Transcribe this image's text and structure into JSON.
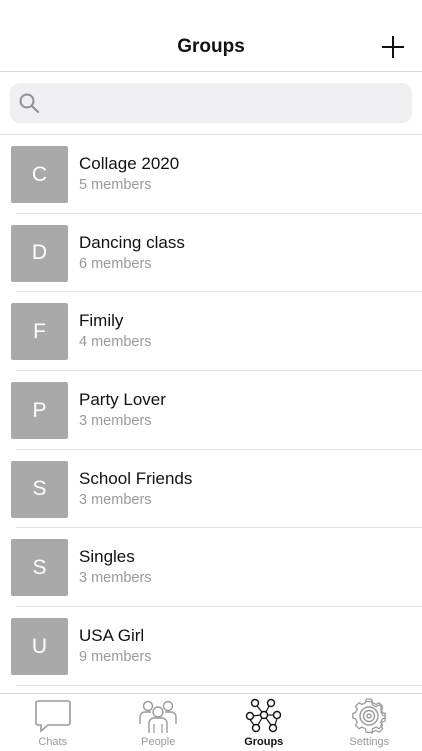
{
  "header": {
    "title": "Groups"
  },
  "search": {
    "placeholder": ""
  },
  "groups": [
    {
      "initial": "C",
      "name": "Collage 2020",
      "members": "5 members"
    },
    {
      "initial": "D",
      "name": "Dancing class",
      "members": "6 members"
    },
    {
      "initial": "F",
      "name": "Fimily",
      "members": "4 members"
    },
    {
      "initial": "P",
      "name": "Party Lover",
      "members": "3 members"
    },
    {
      "initial": "S",
      "name": "School Friends",
      "members": "3 members"
    },
    {
      "initial": "S",
      "name": "Singles",
      "members": "3 members"
    },
    {
      "initial": "U",
      "name": "USA Girl",
      "members": "9 members"
    }
  ],
  "tabbar": {
    "tabs": [
      {
        "label": "Chats",
        "icon": "chat-bubble-icon",
        "active": false
      },
      {
        "label": "People",
        "icon": "people-icon",
        "active": false
      },
      {
        "label": "Groups",
        "icon": "groups-icon",
        "active": true
      },
      {
        "label": "Settings",
        "icon": "gear-icon",
        "active": false
      }
    ]
  },
  "colors": {
    "avatar": "#a9a9a9",
    "inactive": "#9a9a9a",
    "active": "#111111",
    "search_bg": "#efeff1"
  }
}
